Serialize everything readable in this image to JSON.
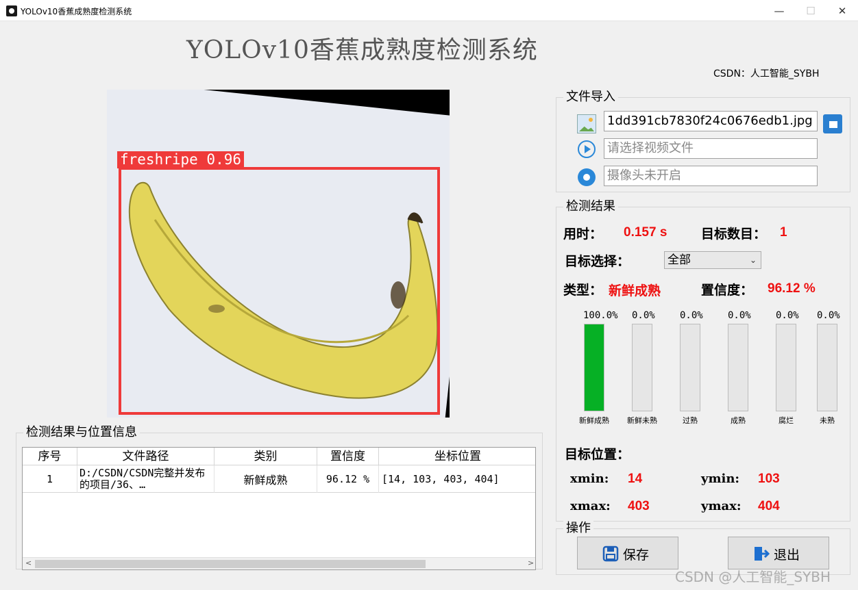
{
  "window": {
    "title": "YOLOv10香蕉成熟度检测系统",
    "minimize": "—",
    "maximize": "☐",
    "close": "✕"
  },
  "header": {
    "title": "YOLOv10香蕉成熟度检测系统",
    "author": "CSDN：人工智能_SYBH"
  },
  "image_view": {
    "detection_label": "freshripe 0.96"
  },
  "file_import": {
    "title": "文件导入",
    "image_file": "1dd391cb7830f24c0676edb1.jpg",
    "video_placeholder": "请选择视频文件",
    "camera_placeholder": "摄像头未开启"
  },
  "results": {
    "title": "检测结果",
    "time_label": "用时：",
    "time_value": "0.157 s",
    "count_label": "目标数目：",
    "count_value": "1",
    "select_label": "目标选择：",
    "select_value": "全部",
    "type_label": "类型：",
    "type_value": "新鲜成熟",
    "conf_label": "置信度：",
    "conf_value": "96.12 %",
    "position_label": "目标位置：",
    "xmin_label": "xmin:",
    "xmin_value": "14",
    "ymin_label": "ymin:",
    "ymin_value": "103",
    "xmax_label": "xmax:",
    "xmax_value": "403",
    "ymax_label": "ymax:",
    "ymax_value": "404",
    "bars": [
      {
        "name": "新鲜成熟",
        "percent_text": "100.0%",
        "level": 1.0
      },
      {
        "name": "新鲜未熟",
        "percent_text": "0.0%",
        "level": 0.0
      },
      {
        "name": "过熟",
        "percent_text": "0.0%",
        "level": 0.0
      },
      {
        "name": "成熟",
        "percent_text": "0.0%",
        "level": 0.0
      },
      {
        "name": "腐烂",
        "percent_text": "0.0%",
        "level": 0.0
      },
      {
        "name": "未熟",
        "percent_text": "0.0%",
        "level": 0.0
      }
    ]
  },
  "actions": {
    "title": "操作",
    "save": "保存",
    "exit": "退出"
  },
  "table": {
    "title": "检测结果与位置信息",
    "headers": [
      "序号",
      "文件路径",
      "类别",
      "置信度",
      "坐标位置"
    ],
    "rows": [
      [
        "1",
        "D:/CSDN/CSDN完整并发布的项目/36、…",
        "新鲜成熟",
        "96.12 %",
        "[14, 103, 403, 404]"
      ]
    ]
  },
  "watermark": "CSDN @人工智能_SYBH",
  "colors": {
    "accent_red": "#ee1111",
    "bar_green": "#06b025",
    "box_red": "#ef3a3a"
  }
}
